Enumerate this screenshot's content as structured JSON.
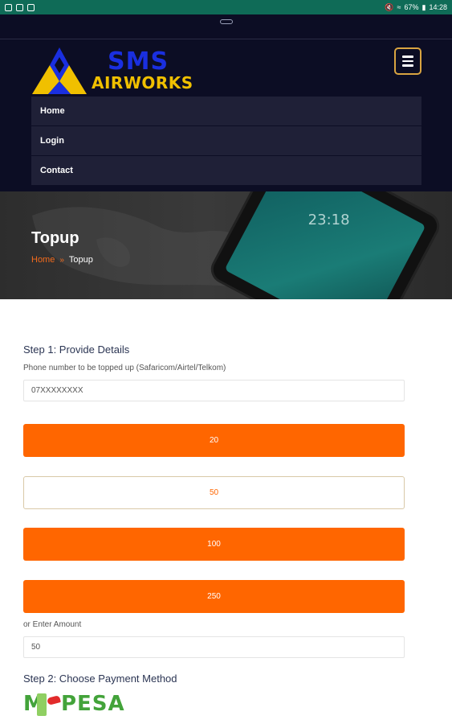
{
  "status_bar": {
    "time": "14:28",
    "battery": "67%"
  },
  "header": {
    "logo_top": "SMS",
    "logo_bottom": "AIRWORKS",
    "menu_icon": "hamburger-menu-icon",
    "nav": [
      {
        "label": "Home"
      },
      {
        "label": "Login"
      },
      {
        "label": "Contact"
      }
    ]
  },
  "hero": {
    "title": "Topup",
    "breadcrumb": {
      "home": "Home",
      "separator": "»",
      "current": "Topup"
    },
    "phone_time": "23:18"
  },
  "form": {
    "step1": "Step 1: Provide Details",
    "phone_label": "Phone number to be topped up (Safaricom/Airtel/Telkom)",
    "phone_placeholder": "07XXXXXXXX",
    "amounts": [
      {
        "label": "20",
        "selected": false
      },
      {
        "label": "50",
        "selected": true
      },
      {
        "label": "100",
        "selected": false
      },
      {
        "label": "250",
        "selected": false
      }
    ],
    "enter_amount_label": "or Enter Amount",
    "amount_value": "50",
    "step2": "Step 2: Choose Payment Method",
    "payment_method": "M-PESA"
  },
  "colors": {
    "accent": "#ff6600",
    "header_bg": "#0c0d24",
    "status_bar": "#0f6b57"
  }
}
